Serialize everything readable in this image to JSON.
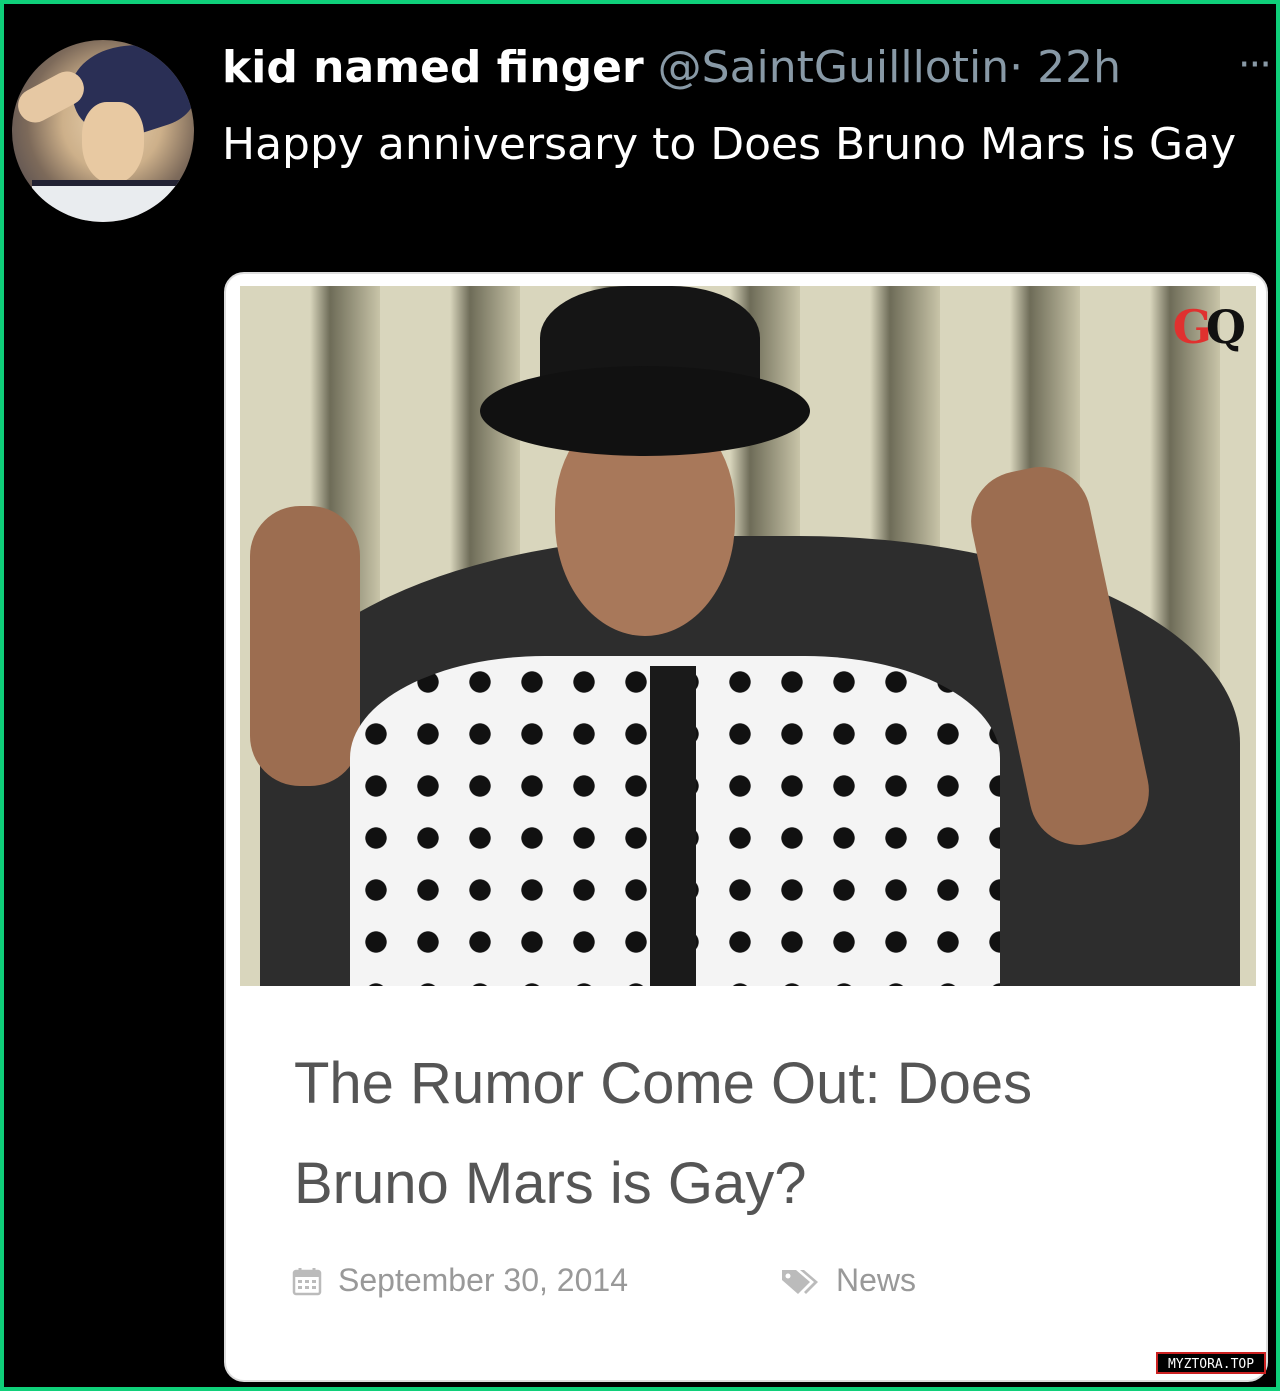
{
  "tweet": {
    "display_name": "kid named finger",
    "handle": "@SaintGuilllotin",
    "separator": "·",
    "time": "22h",
    "more_label": "···",
    "text": "Happy anniversary to Does Bruno Mars is Gay"
  },
  "card": {
    "logo_g": "G",
    "logo_q": "Q",
    "title": "The Rumor Come Out: Does Bruno Mars is Gay?",
    "date": "September 30, 2014",
    "category": "News",
    "date_icon": "calendar-icon",
    "category_icon": "tag-icon"
  },
  "watermark": "MYZTORA.TOP"
}
